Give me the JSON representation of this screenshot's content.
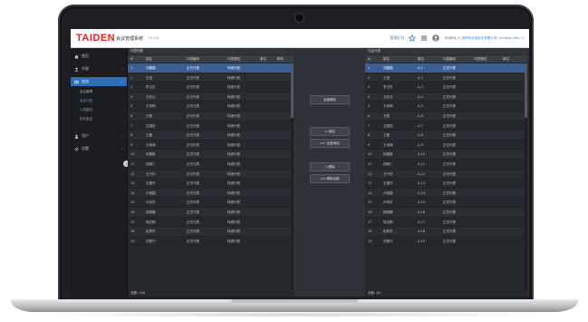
{
  "header": {
    "logo": "TAIDEN",
    "app_title": "会议管理系统",
    "version": "V1.0.0",
    "link": "管理后台",
    "user": "TAIDEN_1",
    "user_detail": "(深圳市台电实业有限公司)",
    "user_extra": "(Android Win...)"
  },
  "sidebar": {
    "items": [
      {
        "label": "首页",
        "icon": "home-icon"
      },
      {
        "label": "代表",
        "icon": "user-icon"
      },
      {
        "label": "会议",
        "icon": "meeting-icon"
      },
      {
        "label": "用户",
        "icon": "person-icon"
      },
      {
        "label": "设置",
        "icon": "gear-icon"
      }
    ],
    "sub_items": [
      "会议管理",
      "会议代表",
      "人员座位",
      "历史会议"
    ],
    "collapse": "‹"
  },
  "left_panel": {
    "title": "代表列表",
    "columns": [
      "#",
      "姓名",
      "代表编号",
      "代表类型",
      "单位",
      "职务"
    ],
    "footer": "总数: 146"
  },
  "right_panel": {
    "title": "与会代表",
    "columns": [
      "#",
      "姓名",
      "座位",
      "代表编号",
      "代表类型",
      "单位"
    ],
    "footer": "总数: 40"
  },
  "middle": {
    "buttons": [
      "全部移除",
      "> 添加",
      ">> 全部添加",
      "< 删除",
      "<< 删除全部"
    ]
  },
  "left_rows": [
    {
      "n": "1",
      "name": "刘建国",
      "code": "正式代表",
      "type": "特邀代表"
    },
    {
      "n": "2",
      "name": "王强",
      "code": "正式代表",
      "type": "特邀代表"
    },
    {
      "n": "3",
      "name": "李卫东",
      "code": "正式代表",
      "type": "特邀代表"
    },
    {
      "n": "4",
      "name": "王彩云",
      "code": "正式代表",
      "type": "特邀代表"
    },
    {
      "n": "5",
      "name": "王伟明",
      "code": "正式代表",
      "type": "特邀代表"
    },
    {
      "n": "6",
      "name": "王燕",
      "code": "正式代表",
      "type": "特邀代表"
    },
    {
      "n": "7",
      "name": "王国庆",
      "code": "正式代表",
      "type": "特邀代表"
    },
    {
      "n": "8",
      "name": "王磊",
      "code": "正式代表",
      "type": "特邀代表"
    },
    {
      "n": "9",
      "name": "王海涛",
      "code": "正式代表",
      "type": "特邀代表"
    },
    {
      "n": "10",
      "name": "钟建新",
      "code": "正式代表",
      "type": "特邀代表"
    },
    {
      "n": "11",
      "name": "钟丽仁",
      "code": "正式代表",
      "type": "特邀代表"
    },
    {
      "n": "12",
      "name": "王兴华",
      "code": "正式代表",
      "type": "特邀代表"
    },
    {
      "n": "13",
      "name": "王建华",
      "code": "正式代表",
      "type": "特邀代表"
    },
    {
      "n": "14",
      "name": "卢保国",
      "code": "正式代表",
      "type": "特邀代表"
    },
    {
      "n": "15",
      "name": "卢伟东",
      "code": "正式代表",
      "type": "特邀代表"
    },
    {
      "n": "16",
      "name": "钟丽娜",
      "code": "正式代表",
      "type": "特邀代表"
    },
    {
      "n": "17",
      "name": "徐志刚",
      "code": "正式代表",
      "type": "特邀代表"
    },
    {
      "n": "18",
      "name": "赵勇东",
      "code": "正式代表",
      "type": "特邀代表"
    },
    {
      "n": "19",
      "name": "刘振兴",
      "code": "正式代表",
      "type": "特邀代表"
    }
  ],
  "right_rows": [
    {
      "n": "1",
      "name": "刘建国",
      "seat": "A-1",
      "code": "正式代表"
    },
    {
      "n": "2",
      "name": "王强",
      "seat": "A-2",
      "code": "正式代表"
    },
    {
      "n": "3",
      "name": "李卫东",
      "seat": "A-3",
      "code": "正式代表"
    },
    {
      "n": "4",
      "name": "王彩云",
      "seat": "A-4",
      "code": "正式代表"
    },
    {
      "n": "5",
      "name": "王伟明",
      "seat": "A-5",
      "code": "正式代表"
    },
    {
      "n": "6",
      "name": "王燕",
      "seat": "A-6",
      "code": "正式代表"
    },
    {
      "n": "7",
      "name": "王国庆",
      "seat": "A-7",
      "code": "正式代表"
    },
    {
      "n": "8",
      "name": "王磊",
      "seat": "A-8",
      "code": "正式代表"
    },
    {
      "n": "9",
      "name": "王海涛",
      "seat": "A-9",
      "code": "正式代表"
    },
    {
      "n": "10",
      "name": "钟建新",
      "seat": "A-10",
      "code": "正式代表"
    },
    {
      "n": "11",
      "name": "钟丽仁",
      "seat": "A-11",
      "code": "正式代表"
    },
    {
      "n": "12",
      "name": "王兴华",
      "seat": "A-12",
      "code": "正式代表"
    },
    {
      "n": "13",
      "name": "王建华",
      "seat": "A-13",
      "code": "正式代表"
    },
    {
      "n": "14",
      "name": "卢保国",
      "seat": "A-14",
      "code": "正式代表"
    },
    {
      "n": "15",
      "name": "卢伟东",
      "seat": "A-15",
      "code": "正式代表"
    },
    {
      "n": "16",
      "name": "钟丽娜",
      "seat": "A-16",
      "code": "正式代表"
    },
    {
      "n": "17",
      "name": "徐志刚",
      "seat": "A-17",
      "code": "正式代表"
    },
    {
      "n": "18",
      "name": "赵勇东",
      "seat": "A-18",
      "code": "正式代表"
    },
    {
      "n": "19",
      "name": "刘振兴",
      "seat": "A-19",
      "code": "正式代表"
    }
  ],
  "colors": {
    "accent": "#2d6fb6",
    "brand": "#e2261c",
    "selected_row": "#3b5f95"
  }
}
